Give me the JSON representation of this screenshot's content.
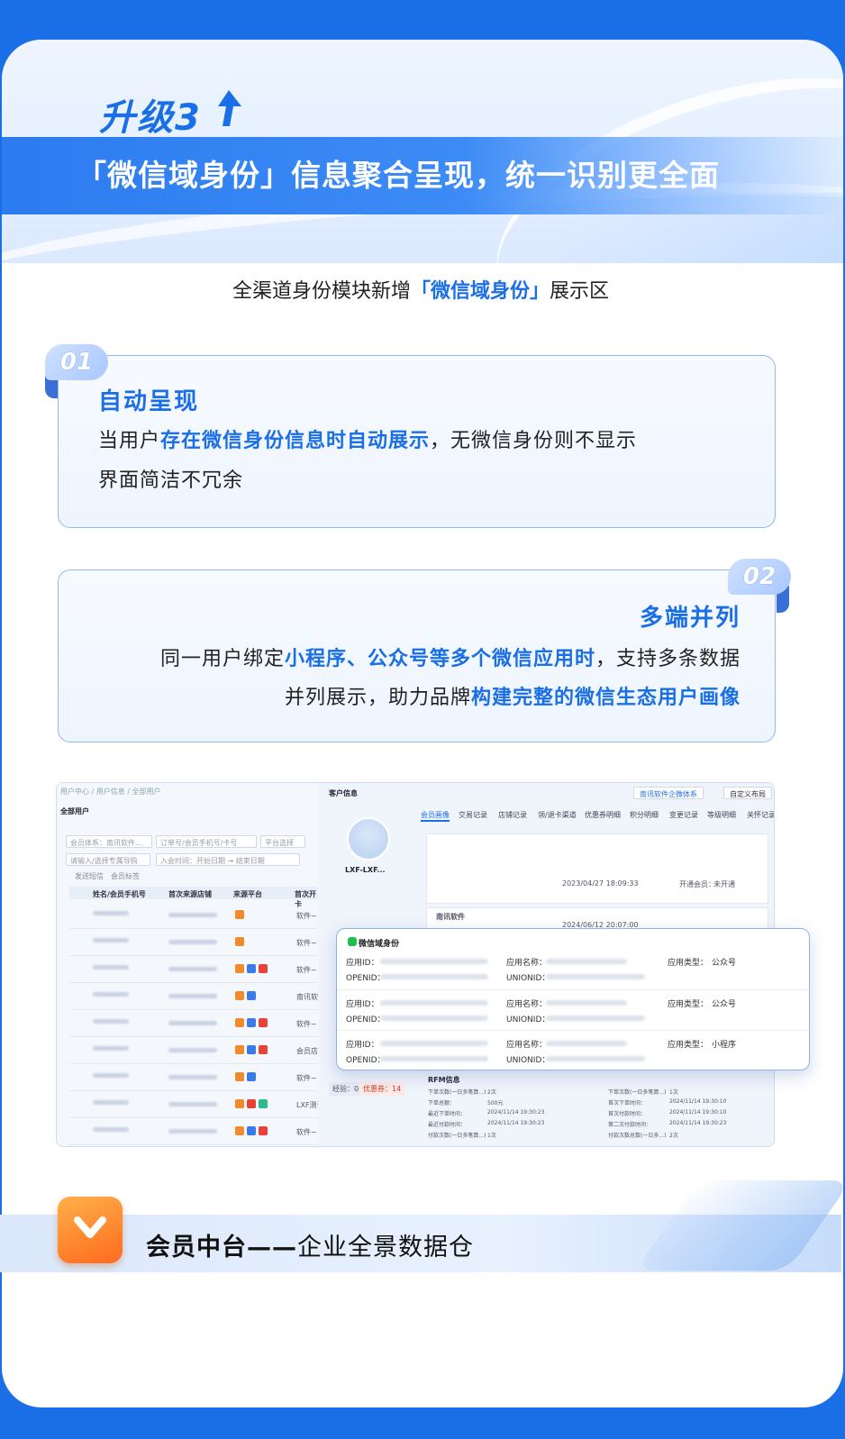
{
  "header": {
    "upgrade_label": "升级3",
    "banner_text": "「微信域身份」信息聚合呈现，统一识别更全面"
  },
  "intro": {
    "prefix": "全渠道身份模块新增",
    "highlight": "「微信域身份」",
    "suffix": "展示区"
  },
  "features": [
    {
      "tag": "01",
      "title": "自动呈现",
      "line1_prefix": "当用户",
      "line1_highlight": "存在微信身份信息时自动展示",
      "line1_suffix": "，无微信身份则不显示",
      "line2": "界面简洁不冗余"
    },
    {
      "tag": "02",
      "title": "多端并列",
      "line1_prefix": "同一用户绑定",
      "line1_highlight": "小程序、公众号等多个微信应用时",
      "line1_suffix": "，支持多条数据",
      "line2_prefix": "并列展示，助力品牌",
      "line2_highlight": "构建完整的微信生态用户画像"
    }
  ],
  "screenshot": {
    "breadcrumb": "用户中心 / 用户信息 / 全部用户",
    "page_title": "全部用户",
    "filters": [
      "会员体系：南讯软件...",
      "订单号/会员手机号/卡号",
      "平台选择",
      "请输入/选择专属导购",
      "入会时间：开始日期 → 结束日期"
    ],
    "links": [
      "发送短信",
      "会员标签"
    ],
    "table_headers": [
      "姓名/会员手机号",
      "首次来源店铺",
      "来源平台",
      "首次开卡"
    ],
    "row_sources": [
      "软件~",
      "软件~",
      "软件~",
      "南讯软件",
      "软件~",
      "会员店",
      "软件~",
      "LXF测试",
      "软件~"
    ],
    "right_title": "客户信息",
    "org_select": "南讯软件企微体系",
    "custom_layout": "自定义布局",
    "customer_name": "LXF-LXF...",
    "tabs": [
      "会员画像",
      "交易记录",
      "店铺记录",
      "领/退卡渠道",
      "优惠券明细",
      "积分明细",
      "变更记录",
      "等级明细",
      "关怀记录"
    ],
    "shop_label": "南讯软件",
    "first_active_1": "2023/04/27 18:09:33",
    "first_active_2": "2024/06/12 20:07:00",
    "open_member": "开通会员：",
    "not_open": "未开通",
    "badges": [
      "经验：0",
      "优惠券：14"
    ],
    "rfm_title": "RFM信息",
    "rfm_rows": [
      [
        "下单次数(一日多笔算...)",
        "2次",
        "下单次数(一日多笔算...)",
        "1次"
      ],
      [
        "下单总额：",
        "500元",
        "首次下单时间：",
        "2024/11/14 19:30:10"
      ],
      [
        "最近下单时间：",
        "2024/11/14 19:30:23",
        "首次付款时间：",
        "2024/11/14 19:30:10"
      ],
      [
        "最近付款时间：",
        "2024/11/14 19:30:23",
        "第二次付款时间：",
        "2024/11/14 19:30:23"
      ],
      [
        "付款次数(一日多笔算...)",
        "1次",
        "付款次数总数(一日多...)",
        "2次"
      ]
    ]
  },
  "wechat_panel": {
    "title": "微信域身份",
    "rows": [
      {
        "app_id_label": "应用ID：",
        "app_name_label": "应用名称：",
        "app_type_label": "应用类型：",
        "app_type": "公众号",
        "openid_label": "OPENID：",
        "unionid_label": "UNIONID："
      },
      {
        "app_id_label": "应用ID：",
        "app_name_label": "应用名称：",
        "app_type_label": "应用类型：",
        "app_type": "公众号",
        "openid_label": "OPENID：",
        "unionid_label": "UNIONID："
      },
      {
        "app_id_label": "应用ID：",
        "app_name_label": "应用名称：",
        "app_type_label": "应用类型：",
        "app_type": "小程序",
        "openid_label": "OPENID：",
        "unionid_label": "UNIONID："
      }
    ]
  },
  "footer": {
    "brand": "会员中台——",
    "slogan": "企业全景数据仓"
  },
  "colors": {
    "accent": "#1a6fe6",
    "background": "#1a6fe6",
    "logo": "#ff7a22"
  }
}
